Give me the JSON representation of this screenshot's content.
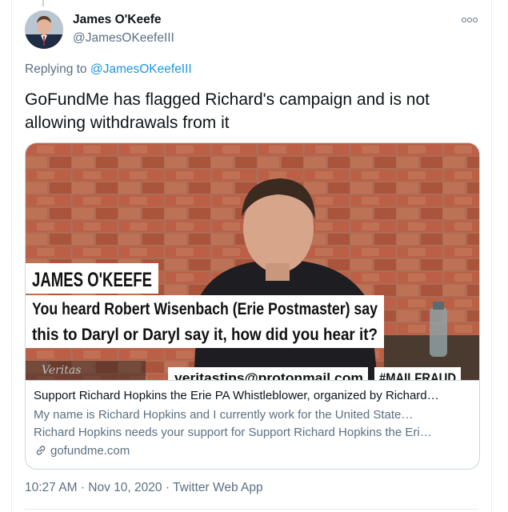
{
  "author": {
    "name": "James O'Keefe",
    "handle": "@JamesOKeefeIII"
  },
  "reply": {
    "prefix": "Replying to",
    "target": "@JamesOKeefeIII"
  },
  "tweet": {
    "line1": "GoFundMe has flagged Richard's campaign and is not",
    "line2": "allowing withdrawals from it"
  },
  "card": {
    "media": {
      "name_lower_third": "JAMES O'KEEFE",
      "caption_line1": "You heard Robert Wisenbach (Erie Postmaster) say",
      "caption_line2": "this to Daryl or Daryl say it, how did you hear it?",
      "email": "veritastips@protonmail.com",
      "hashtag": "#MAILFRAUD",
      "watermark": "Veritas"
    },
    "title": "Support Richard Hopkins the Erie PA Whistleblower, organized by Richard…",
    "description_line1": "My name is Richard Hopkins and I currently work for the United State…",
    "description_line2": "Richard Hopkins needs your support for Support Richard Hopkins the Eri…",
    "domain": "gofundme.com"
  },
  "meta": {
    "time": "10:27 AM",
    "date": "Nov 10, 2020",
    "source": "Twitter Web App",
    "separator": "·"
  },
  "colors": {
    "link": "#1b95e0",
    "secondary_text": "#5b7083",
    "border": "#ccd6dd"
  },
  "icons": {
    "more": "more-dots-icon",
    "link": "link-icon"
  }
}
